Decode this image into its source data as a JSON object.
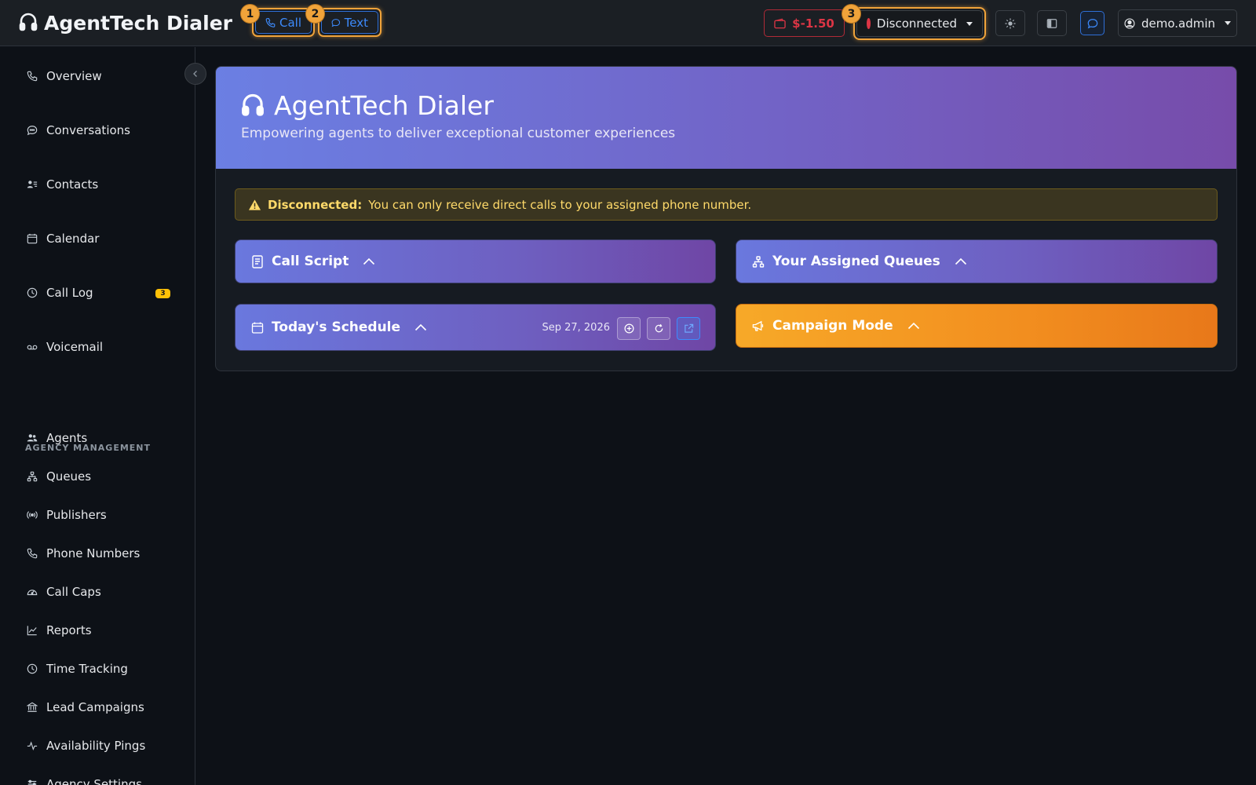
{
  "app": {
    "title": "AgentTech Dialer"
  },
  "topbar": {
    "call_label": "Call",
    "text_label": "Text",
    "badge_1": "1",
    "badge_2": "2",
    "badge_3": "3",
    "balance": "$-1.50",
    "status": "Disconnected",
    "user": "demo.admin"
  },
  "sidebar": {
    "items": [
      {
        "label": "Overview",
        "icon": "phone-icon"
      },
      {
        "label": "Conversations",
        "icon": "chat-icon"
      },
      {
        "label": "Contacts",
        "icon": "contacts-icon"
      },
      {
        "label": "Calendar",
        "icon": "calendar-icon"
      },
      {
        "label": "Call Log",
        "icon": "clock-icon",
        "badge": "3"
      },
      {
        "label": "Voicemail",
        "icon": "voicemail-icon"
      }
    ],
    "section_label": "AGENCY MANAGEMENT",
    "mgmt_items": [
      {
        "label": "Agents",
        "icon": "people-icon"
      },
      {
        "label": "Queues",
        "icon": "diagram-icon"
      },
      {
        "label": "Publishers",
        "icon": "broadcast-icon"
      },
      {
        "label": "Phone Numbers",
        "icon": "phone-icon"
      },
      {
        "label": "Call Caps",
        "icon": "speedometer-icon"
      },
      {
        "label": "Reports",
        "icon": "graph-icon"
      },
      {
        "label": "Time Tracking",
        "icon": "clock-icon"
      },
      {
        "label": "Lead Campaigns",
        "icon": "bank-icon"
      },
      {
        "label": "Availability Pings",
        "icon": "pulse-icon"
      },
      {
        "label": "Agency Settings",
        "icon": "sliders-icon"
      }
    ]
  },
  "hero": {
    "title": "AgentTech Dialer",
    "subtitle": "Empowering agents to deliver exceptional customer experiences"
  },
  "alert": {
    "strong": "Disconnected:",
    "message": "You can only receive direct calls to your assigned phone number."
  },
  "panels": {
    "call_script": "Call Script",
    "assigned_queues": "Your Assigned Queues",
    "todays_schedule": "Today's Schedule",
    "schedule_date": "Sep 27, 2026",
    "campaign_mode": "Campaign Mode"
  },
  "colors": {
    "accent_orange": "#f0a33a",
    "danger": "#dc3545",
    "primary": "#3d8bfd",
    "warning": "#ffc107"
  }
}
